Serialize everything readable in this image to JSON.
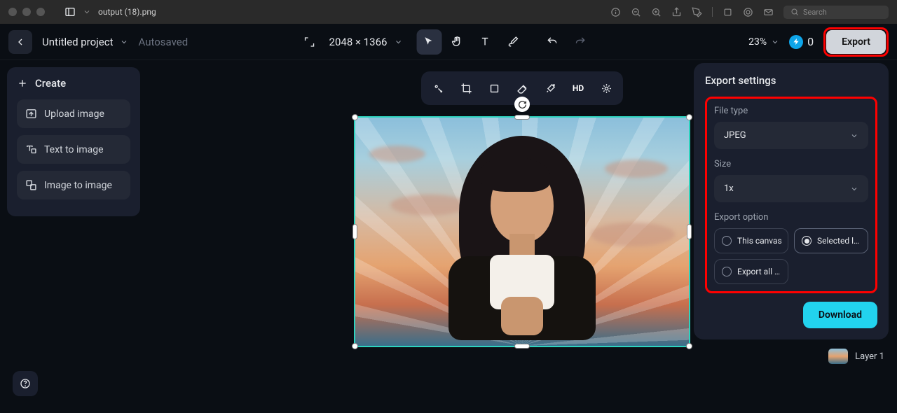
{
  "titlebar": {
    "filename": "output (18).png",
    "search_placeholder": "Search"
  },
  "toolbar": {
    "project_name": "Untitled project",
    "autosaved": "Autosaved",
    "dimensions": "2048 × 1366",
    "zoom": "23%",
    "credits": "0",
    "export_label": "Export"
  },
  "sidebar": {
    "create_label": "Create",
    "items": [
      {
        "label": "Upload image"
      },
      {
        "label": "Text to image"
      },
      {
        "label": "Image to image"
      }
    ]
  },
  "float_tools": {
    "hd": "HD"
  },
  "export_panel": {
    "title": "Export settings",
    "file_type_label": "File type",
    "file_type_value": "JPEG",
    "size_label": "Size",
    "size_value": "1x",
    "export_option_label": "Export option",
    "opt_canvas": "This canvas",
    "opt_selected": "Selected l…",
    "opt_all": "Export all …",
    "download": "Download"
  },
  "layer": {
    "name": "Layer 1"
  }
}
